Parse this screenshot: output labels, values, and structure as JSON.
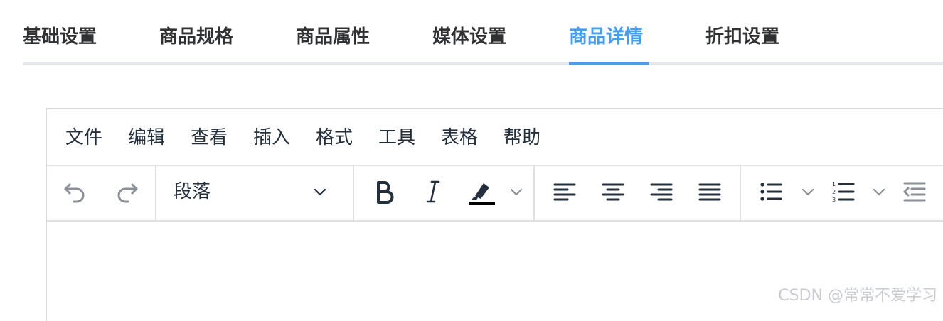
{
  "tabs": [
    {
      "label": "基础设置"
    },
    {
      "label": "商品规格"
    },
    {
      "label": "商品属性"
    },
    {
      "label": "媒体设置"
    },
    {
      "label": "商品详情",
      "active": true
    },
    {
      "label": "折扣设置"
    }
  ],
  "editor": {
    "menu": [
      "文件",
      "编辑",
      "查看",
      "插入",
      "格式",
      "工具",
      "表格",
      "帮助"
    ],
    "block_format": "段落",
    "toolbar_icons": [
      "undo-icon",
      "redo-icon",
      "bold-icon",
      "italic-icon",
      "highlight-color-icon",
      "align-left-icon",
      "align-center-icon",
      "align-right-icon",
      "align-justify-icon",
      "bullet-list-icon",
      "numbered-list-icon",
      "outdent-icon"
    ]
  },
  "colors": {
    "accent": "#409eff",
    "text": "#303133",
    "border": "#e4e7ed"
  },
  "watermark": "CSDN @常常不爱学习"
}
